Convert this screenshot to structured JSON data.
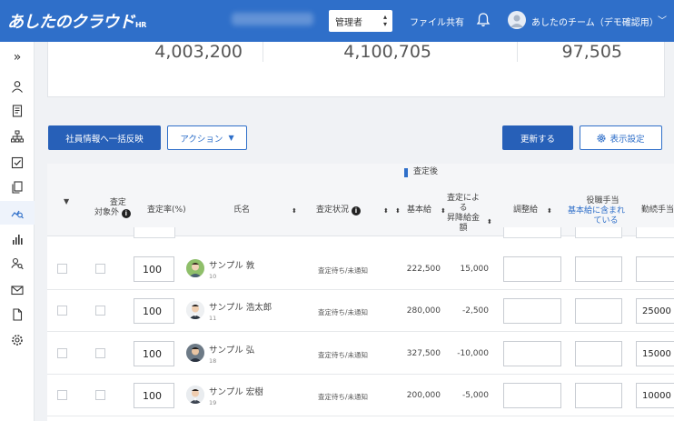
{
  "header": {
    "logo_text": "あしたのクラウド",
    "logo_sub": "HR",
    "role_select": "管理者",
    "file_share": "ファイル共有",
    "team_name": "あしたのチーム（デモ確認用）"
  },
  "sidebar": {
    "items": [
      "collapse-icon",
      "user-icon",
      "document-icon",
      "org-chart-icon",
      "checklist-icon",
      "copy-icon",
      "assessment-search-icon",
      "bar-chart-icon",
      "person-search-icon",
      "mail-icon",
      "file-icon",
      "settings-icon"
    ],
    "active": "assessment-search-icon"
  },
  "summary": {
    "values": [
      "4,003,200",
      "4,100,705",
      "97,505"
    ]
  },
  "toolbar": {
    "reflect_button": "社員情報へ一括反映",
    "action_button": "アクション",
    "update_button": "更新する",
    "display_settings_button": "表示設定"
  },
  "table": {
    "group_header": "査定後",
    "headers": {
      "exclude": "査定\n対象外",
      "rate": "査定率(%)",
      "name": "氏名",
      "status": "査定状況",
      "base": "基本給",
      "raise": "査定によ\nる\n昇降給金\n額",
      "adjust": "調整給",
      "title_allowance": "役職手当",
      "title_allowance_note": "基本給に含まれ\nている",
      "tenure_allowance": "勤続手当"
    },
    "rows": [
      {
        "rate": "100",
        "name": "サンプル 敦",
        "id": "10",
        "status": "査定待ち/未通知",
        "base": "222,500",
        "raise": "15,000",
        "tenure": ""
      },
      {
        "rate": "100",
        "name": "サンプル 浩太郎",
        "id": "11",
        "status": "査定待ち/未通知",
        "base": "280,000",
        "raise": "-2,500",
        "tenure": "25000"
      },
      {
        "rate": "100",
        "name": "サンプル 弘",
        "id": "18",
        "status": "査定待ち/未通知",
        "base": "327,500",
        "raise": "-10,000",
        "tenure": "15000"
      },
      {
        "rate": "100",
        "name": "サンプル 宏樹",
        "id": "19",
        "status": "査定待ち/未通知",
        "base": "200,000",
        "raise": "-5,000",
        "tenure": "10000"
      }
    ]
  },
  "colors": {
    "brand": "#2f6fc9",
    "primary_button": "#2760b8"
  }
}
